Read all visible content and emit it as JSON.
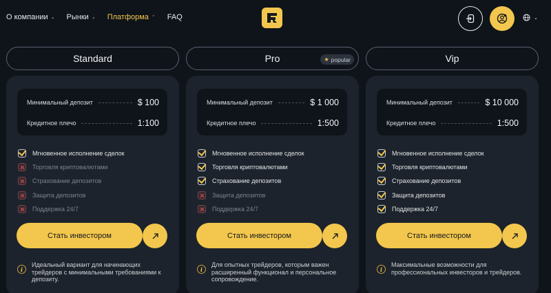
{
  "nav": {
    "items": [
      {
        "label": "О компании",
        "has_chevron": true,
        "active": false
      },
      {
        "label": "Рынки",
        "has_chevron": true,
        "active": false
      },
      {
        "label": "Платформа",
        "has_chevron": true,
        "active": true
      },
      {
        "label": "FAQ",
        "has_chevron": false,
        "active": false
      }
    ]
  },
  "header": {
    "logo_icon": "brand-logo-icon",
    "login_icon": "login-icon",
    "profile_icon": "profile-icon",
    "lang_icon": "globe-icon"
  },
  "colors": {
    "accent": "#f3c74d",
    "background": "#0f141b",
    "card": "#1d232c",
    "danger": "#d65a5a"
  },
  "plans": [
    {
      "name": "Standard",
      "badge": "",
      "stats": [
        {
          "label": "Минимальный депозит",
          "value": "$ 100"
        },
        {
          "label": "Кредитное плечо",
          "value": "1:100"
        }
      ],
      "features": [
        {
          "label": "Мгновенное исполнение сделок",
          "enabled": true
        },
        {
          "label": "Торговля криптовалютами",
          "enabled": false
        },
        {
          "label": "Страхование депозитов",
          "enabled": false
        },
        {
          "label": "Защита депозитов",
          "enabled": false
        },
        {
          "label": "Поддержка 24/7",
          "enabled": false
        }
      ],
      "cta": "Стать инвестором",
      "note": "Идеальный вариант для начинающих трейдеров с минимальными требованиями к депозиту."
    },
    {
      "name": "Pro",
      "badge": "popular",
      "stats": [
        {
          "label": "Минимальный депозит",
          "value": "$ 1 000"
        },
        {
          "label": "Кредитное плечо",
          "value": "1:500"
        }
      ],
      "features": [
        {
          "label": "Мгновенное исполнение сделок",
          "enabled": true
        },
        {
          "label": "Торговля криптовалютами",
          "enabled": true
        },
        {
          "label": "Страхование депозитов",
          "enabled": true
        },
        {
          "label": "Защита депозитов",
          "enabled": false
        },
        {
          "label": "Поддержка 24/7",
          "enabled": false
        }
      ],
      "cta": "Стать инвестором",
      "note": "Для опытных трейдеров, которым важен расширенный функционал и персональное сопровождение."
    },
    {
      "name": "Vip",
      "badge": "",
      "stats": [
        {
          "label": "Минимальный депозит",
          "value": "$ 10 000"
        },
        {
          "label": "Кредитное плечо",
          "value": "1:500"
        }
      ],
      "features": [
        {
          "label": "Мгновенное исполнение сделок",
          "enabled": true
        },
        {
          "label": "Торговля криптовалютами",
          "enabled": true
        },
        {
          "label": "Страхование депозитов",
          "enabled": true
        },
        {
          "label": "Защита депозитов",
          "enabled": true
        },
        {
          "label": "Поддержка 24/7",
          "enabled": true
        }
      ],
      "cta": "Стать инвестором",
      "note": "Максимальные возможности для профессиональных инвесторов и трейдеров."
    }
  ]
}
